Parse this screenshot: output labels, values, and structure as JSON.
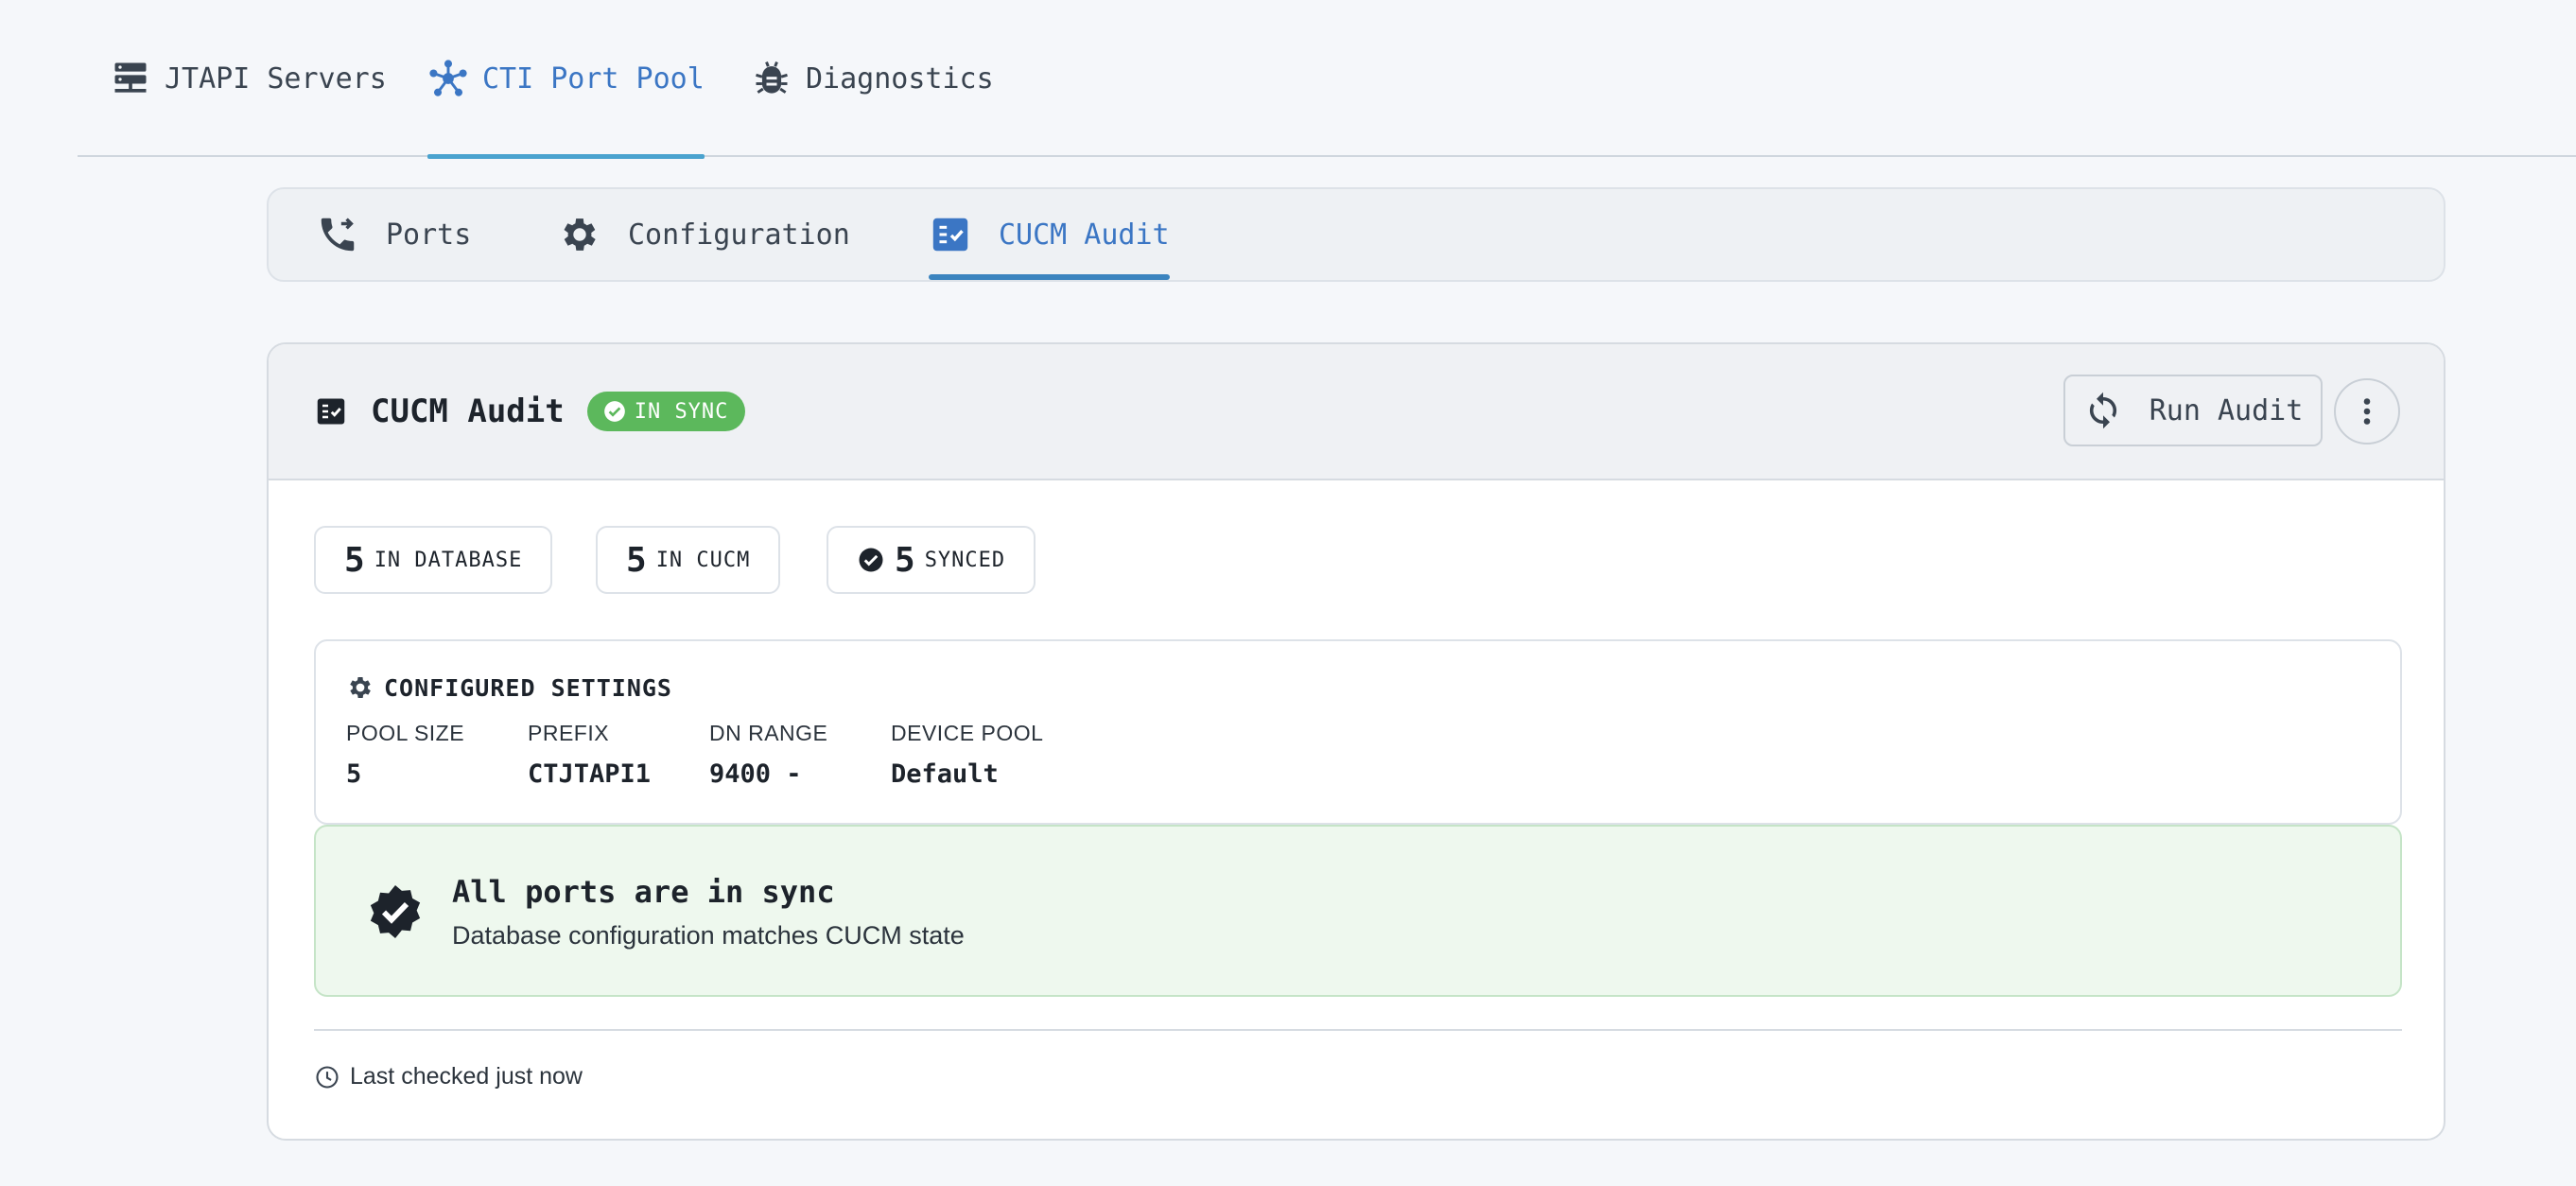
{
  "top_tabs": [
    {
      "label": "JTAPI Servers",
      "icon": "server-icon",
      "active": false
    },
    {
      "label": "CTI Port Pool",
      "icon": "hub-icon",
      "active": true
    },
    {
      "label": "Diagnostics",
      "icon": "bug-icon",
      "active": false
    }
  ],
  "sub_tabs": [
    {
      "label": "Ports",
      "icon": "phone-forward-icon",
      "active": false
    },
    {
      "label": "Configuration",
      "icon": "gear-icon",
      "active": false
    },
    {
      "label": "CUCM Audit",
      "icon": "checklist-icon",
      "active": true
    }
  ],
  "card": {
    "title": "CUCM Audit",
    "status_badge": "IN SYNC",
    "run_audit_label": "Run Audit"
  },
  "stats": [
    {
      "value": "5",
      "label": "IN DATABASE"
    },
    {
      "value": "5",
      "label": "IN CUCM"
    },
    {
      "value": "5",
      "label": "SYNCED"
    }
  ],
  "config": {
    "title": "CONFIGURED SETTINGS",
    "fields": [
      {
        "label": "POOL SIZE",
        "value": "5"
      },
      {
        "label": "PREFIX",
        "value": "CTJTAPI1"
      },
      {
        "label": "DN RANGE",
        "value": "9400 -"
      },
      {
        "label": "DEVICE POOL",
        "value": "Default"
      }
    ]
  },
  "sync_message": {
    "heading": "All ports are in sync",
    "detail": "Database configuration matches CUCM state"
  },
  "footer": {
    "last_checked": "Last checked just now"
  },
  "colors": {
    "accent": "#3b76c4",
    "success": "#5cb85c",
    "success_bg": "#eef8ee"
  }
}
